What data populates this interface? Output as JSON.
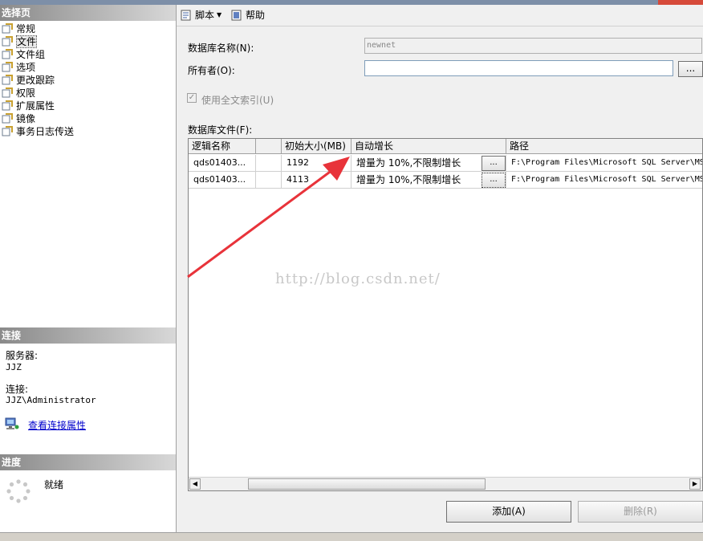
{
  "left_pane": {
    "select_page_header": "选择页",
    "nav_items": [
      {
        "label": "常规",
        "active": false
      },
      {
        "label": "文件",
        "active": true
      },
      {
        "label": "文件组",
        "active": false
      },
      {
        "label": "选项",
        "active": false
      },
      {
        "label": "更改跟踪",
        "active": false
      },
      {
        "label": "权限",
        "active": false
      },
      {
        "label": "扩展属性",
        "active": false
      },
      {
        "label": "镜像",
        "active": false
      },
      {
        "label": "事务日志传送",
        "active": false
      }
    ],
    "connection_header": "连接",
    "server_label": "服务器:",
    "server_value": "JJZ",
    "connection_label": "连接:",
    "connection_value": "JJZ\\Administrator",
    "view_connection_link": "查看连接属性",
    "progress_header": "进度",
    "progress_status": "就绪"
  },
  "toolbar": {
    "script_label": "脚本",
    "help_label": "帮助"
  },
  "form": {
    "db_name_label": "数据库名称(N):",
    "db_name_value": "newnet",
    "owner_label": "所有者(O):",
    "owner_value": "",
    "browse_label": "...",
    "fulltext_label": "使用全文索引(U)",
    "fulltext_checked": true,
    "db_files_label": "数据库文件(F):"
  },
  "grid": {
    "columns": [
      "逻辑名称",
      "",
      "初始大小(MB)",
      "自动增长",
      "路径"
    ],
    "rows": [
      {
        "logical_name": "qds01403...",
        "type": "",
        "size": "1192",
        "autogrowth": "增量为 10%,不限制增长",
        "path": "F:\\Program Files\\Microsoft SQL Server\\MS"
      },
      {
        "logical_name": "qds01403...",
        "type": "",
        "size": "4113",
        "autogrowth": "增量为 10%,不限制增长",
        "path": "F:\\Program Files\\Microsoft SQL Server\\MS"
      }
    ],
    "cell_button_label": "..."
  },
  "watermark": "http://blog.csdn.net/",
  "buttons": {
    "add_label": "添加(A)",
    "remove_label": "删除(R)"
  },
  "colors": {
    "arrow": "#e8333a",
    "link": "#0000cc"
  }
}
